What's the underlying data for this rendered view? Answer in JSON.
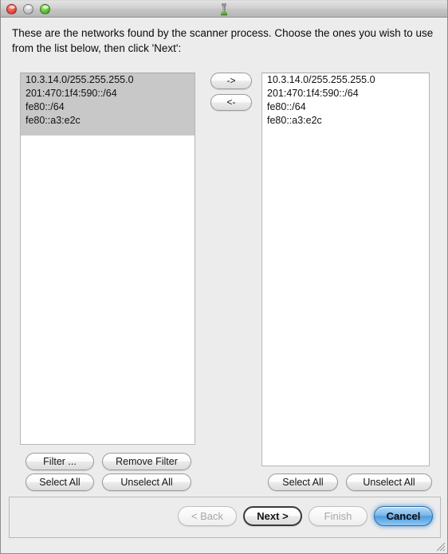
{
  "window": {
    "traffic_lights": [
      {
        "name": "close",
        "icon": "close-window-button"
      },
      {
        "name": "minimize",
        "icon": "minimize-window-button"
      },
      {
        "name": "zoom",
        "icon": "zoom-window-button"
      }
    ],
    "title_icon": "tower-app-icon"
  },
  "prompt": {
    "text": "These are the networks found by the scanner process. Choose the ones you wish to use from the list below, then click 'Next':"
  },
  "available_list": {
    "items": [
      {
        "label": "10.3.14.0/255.255.255.0",
        "selected": true
      },
      {
        "label": "201:470:1f4:590::/64",
        "selected": true
      },
      {
        "label": "fe80::/64",
        "selected": true
      },
      {
        "label": "fe80::a3:e2c",
        "selected": true
      }
    ]
  },
  "transfer_buttons": {
    "add_label": "->",
    "remove_label": "<-"
  },
  "selected_list": {
    "items": [
      {
        "label": "10.3.14.0/255.255.255.0",
        "selected": false
      },
      {
        "label": "201:470:1f4:590::/64",
        "selected": false
      },
      {
        "label": "fe80::/64",
        "selected": false
      },
      {
        "label": "fe80::a3:e2c",
        "selected": false
      }
    ]
  },
  "left_controls": {
    "filter_label": "Filter ...",
    "remove_filter_label": "Remove Filter",
    "select_all_label": "Select All",
    "unselect_all_label": "Unselect All"
  },
  "right_controls": {
    "select_all_label": "Select All",
    "unselect_all_label": "Unselect All"
  },
  "navigation": {
    "back_label": "< Back",
    "next_label": "Next >",
    "finish_label": "Finish",
    "cancel_label": "Cancel"
  },
  "colors": {
    "window_background": "#ececec",
    "list_background": "#ffffff",
    "selection": "#c8c8c8",
    "default_button": "#4f9ce0",
    "disabled_text": "#a6a6a6"
  }
}
